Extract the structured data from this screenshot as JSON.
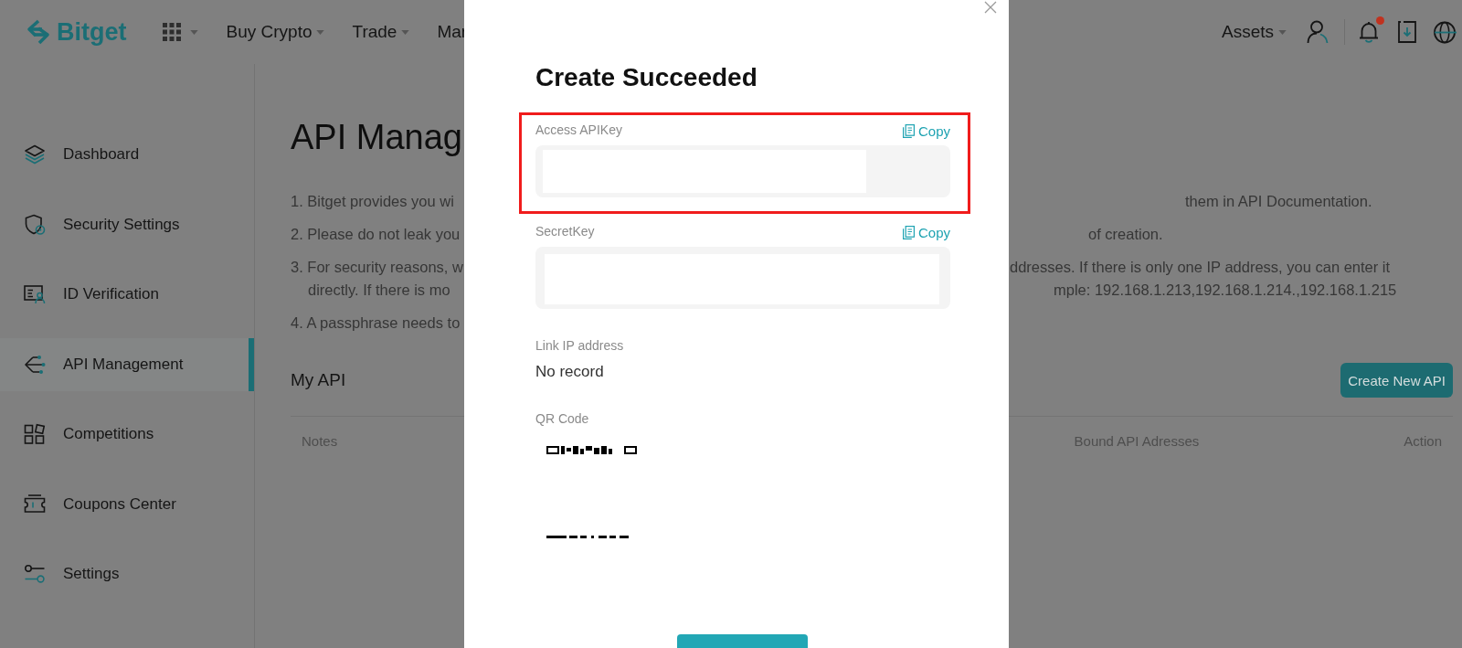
{
  "header": {
    "logo": "Bitget",
    "nav": [
      {
        "label": "Buy Crypto",
        "caret": true
      },
      {
        "label": "Trade",
        "caret": true
      },
      {
        "label": "Mar",
        "caret": false
      }
    ],
    "assets": "Assets",
    "notifications": {
      "unread": true
    }
  },
  "sidebar": {
    "items": [
      {
        "label": "Dashboard",
        "selected": false
      },
      {
        "label": "Security Settings",
        "selected": false
      },
      {
        "label": "ID Verification",
        "selected": false
      },
      {
        "label": "API Management",
        "selected": true
      },
      {
        "label": "Competitions",
        "selected": false
      },
      {
        "label": "Coupons Center",
        "selected": false
      },
      {
        "label": "Settings",
        "selected": false
      }
    ]
  },
  "page": {
    "title": "API Manag",
    "notes": [
      {
        "lines": [
          {
            "left": "1. Bitget provides you wi",
            "right": "them in API Documentation."
          }
        ]
      },
      {
        "lines": [
          {
            "left": "2. Please do not leak you",
            "right": "of creation."
          }
        ]
      },
      {
        "lines": [
          {
            "left": "3. For security reasons, w",
            "right": "ddresses. If there is only one IP address, you can enter it"
          },
          {
            "left": "directly. If there is mo",
            "right": "mple: 192.168.1.213,192.168.1.214.,192.168.1.215"
          }
        ]
      },
      {
        "lines": [
          {
            "left": "4. A passphrase needs to"
          }
        ]
      }
    ],
    "section_title": "My API",
    "create_button": "Create New API",
    "table": {
      "columns": [
        "Notes",
        "Bound API Adresses",
        "Action"
      ]
    }
  },
  "modal": {
    "title": "Create Succeeded",
    "fields": [
      {
        "label": "Access APIKey",
        "copy": "Copy",
        "highlighted": true
      },
      {
        "label": "SecretKey",
        "copy": "Copy",
        "highlighted": false
      }
    ],
    "ip": {
      "label": "Link IP address",
      "value": "No record"
    },
    "qr": {
      "label": "QR Code"
    }
  }
}
